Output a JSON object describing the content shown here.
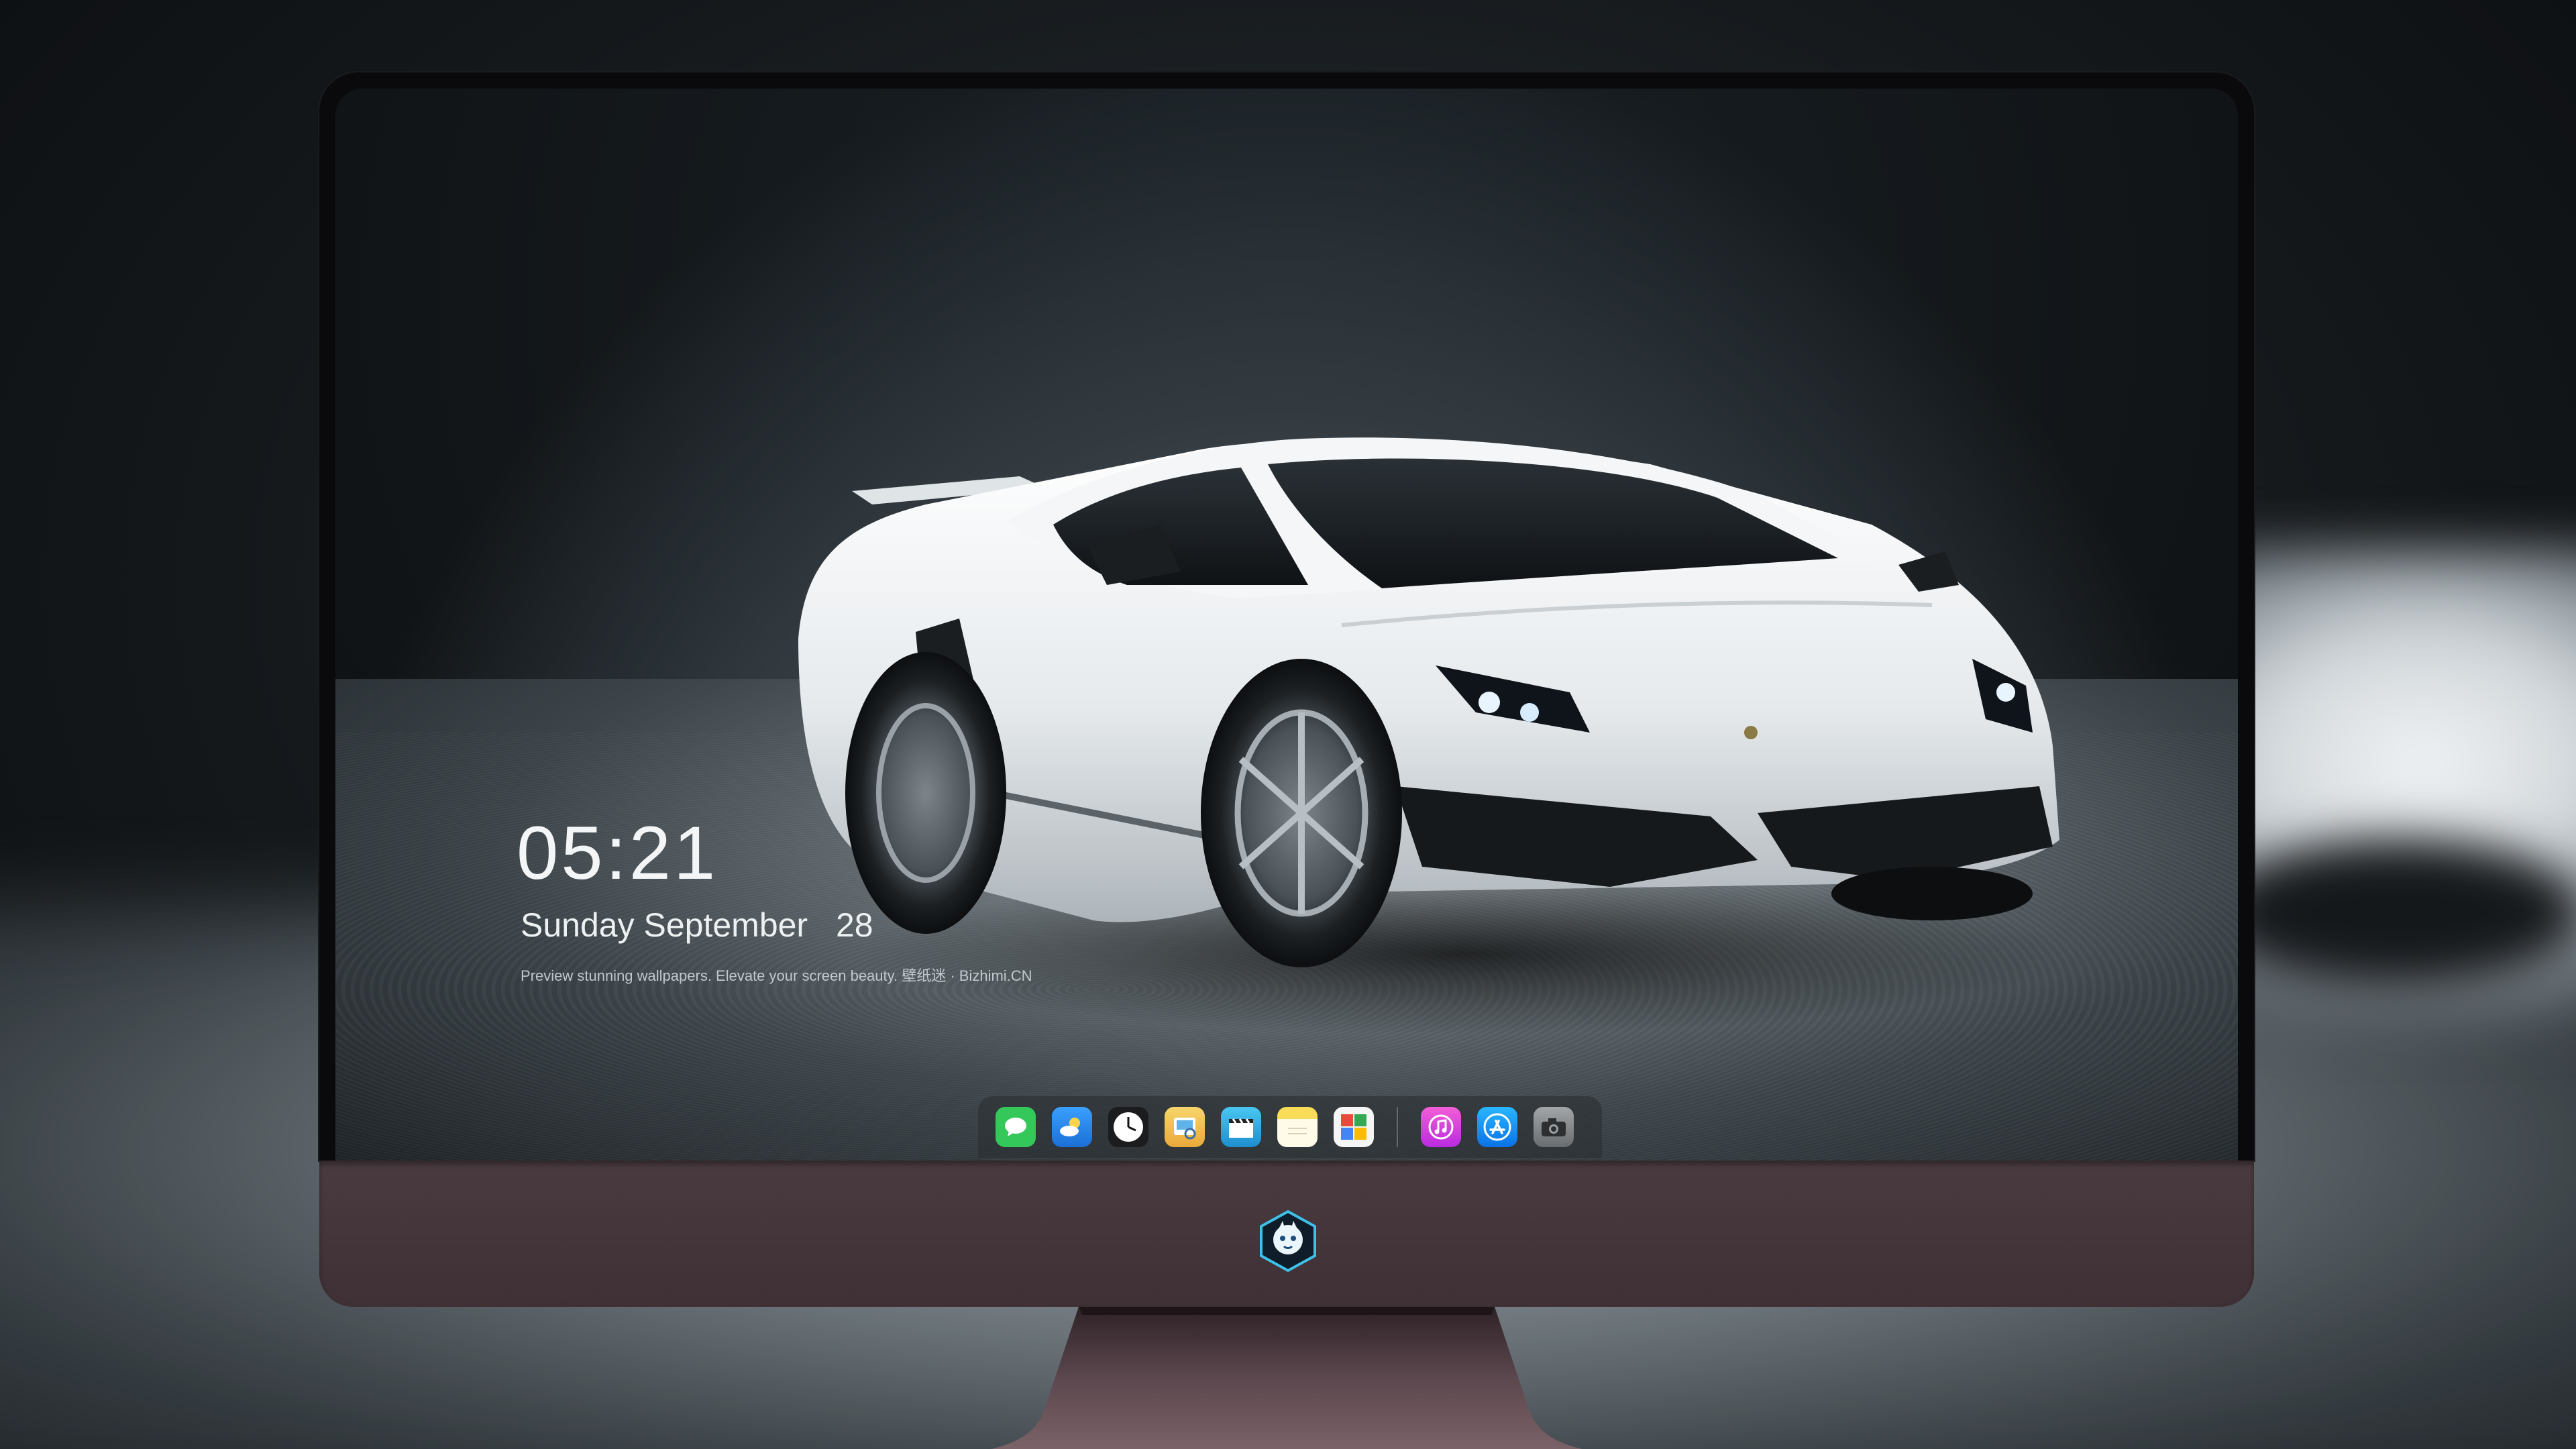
{
  "lockscreen": {
    "time": "05:21",
    "weekday": "Sunday",
    "month": "September",
    "day": "28",
    "tagline": "Preview stunning wallpapers. Elevate your screen beauty. 壁纸迷 · Bizhimi.CN"
  },
  "dock": {
    "items": [
      {
        "name": "messages-icon",
        "color": "#34c759"
      },
      {
        "name": "weather-icon",
        "color": "#2a8cf0"
      },
      {
        "name": "clock-icon",
        "color": "#f2f2f2"
      },
      {
        "name": "preview-icon",
        "color": "#f3c84b"
      },
      {
        "name": "clips-icon",
        "color": "#35b7e8"
      },
      {
        "name": "notes-icon",
        "color": "#f8d648"
      },
      {
        "name": "photo-booth-icon",
        "color": "#e84b3c"
      },
      {
        "name": "itunes-icon",
        "color": "#d63fe0"
      },
      {
        "name": "app-store-icon",
        "color": "#1a8df5"
      },
      {
        "name": "camera-icon",
        "color": "#8d8f92"
      }
    ]
  },
  "colors": {
    "chin": "#4a3b40",
    "bezel": "#0a0a0c"
  }
}
